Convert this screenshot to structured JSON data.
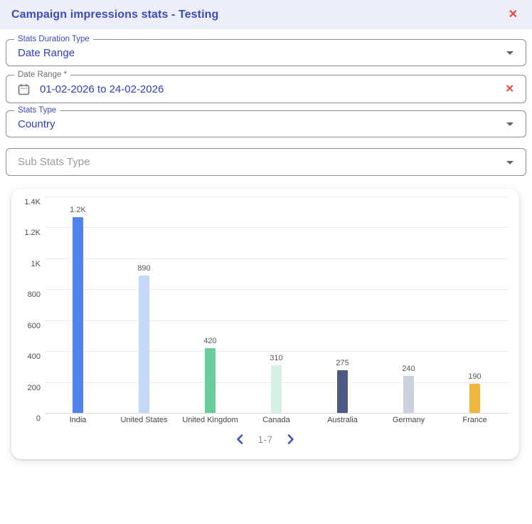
{
  "header": {
    "title": "Campaign impressions stats - Testing",
    "close_icon": "✕"
  },
  "form": {
    "stats_duration_type": {
      "label": "Stats Duration Type",
      "value": "Date Range"
    },
    "date_range": {
      "label": "Date Range *",
      "value": "01-02-2026 to 24-02-2026",
      "clear_icon": "✕"
    },
    "stats_type": {
      "label": "Stats Type",
      "value": "Country"
    },
    "sub_stats_type": {
      "placeholder": "Sub Stats Type"
    }
  },
  "chart_data": {
    "type": "bar",
    "categories": [
      "India",
      "United States",
      "United Kingdom",
      "Canada",
      "Australia",
      "Germany",
      "France"
    ],
    "values": [
      1266,
      890,
      420,
      310,
      275,
      240,
      190
    ],
    "value_labels": [
      "1.2K",
      "890",
      "420",
      "310",
      "275",
      "240",
      "190"
    ],
    "bar_colors": [
      "#5083EE",
      "#C6D8F8",
      "#67CD99",
      "#D4F1E3",
      "#4A5C84",
      "#CBD2DE",
      "#EDB83D"
    ],
    "title": "",
    "xlabel": "",
    "ylabel": "",
    "ylim": [
      0,
      1400
    ],
    "ytick_labels": [
      "1.4K",
      "1.2K",
      "1K",
      "800",
      "600",
      "400",
      "200",
      "0"
    ],
    "grid": true,
    "legend": false
  },
  "pagination": {
    "range": "1-7"
  },
  "colors": {
    "accent": "#3A4BC0",
    "danger": "#E8483C",
    "header_bg": "#EDEEF7",
    "grid": "#ECECEC"
  },
  "icons": {
    "close": "close-icon",
    "calendar": "calendar-icon",
    "dropdown": "chevron-down-icon",
    "prev": "chevron-left-icon",
    "next": "chevron-right-icon"
  }
}
